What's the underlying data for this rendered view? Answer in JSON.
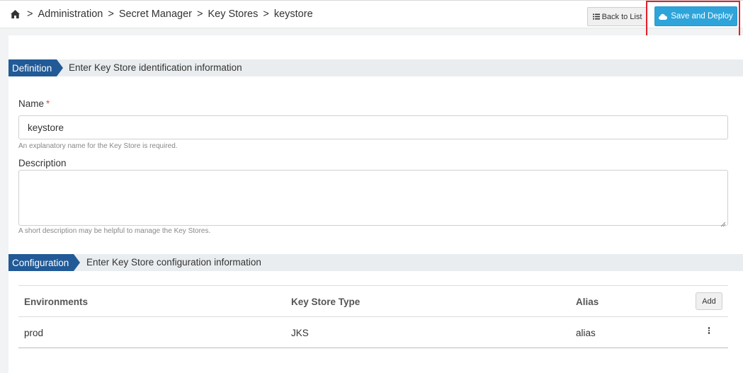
{
  "breadcrumb": {
    "home_icon": "home-icon",
    "separator": ">",
    "items": [
      "Administration",
      "Secret Manager",
      "Key Stores",
      "keystore"
    ]
  },
  "toolbar": {
    "back_label": "Back to List",
    "back_icon": "list-icon",
    "save_label": "Save and Deploy",
    "save_icon": "cloud-icon",
    "save_color": "#2ea4da",
    "highlight_color": "#e0202a"
  },
  "definition": {
    "tag": "Definition",
    "description": "Enter Key Store identification information",
    "name_label": "Name",
    "required_marker": "*",
    "name_value": "keystore",
    "name_help": "An explanatory name for the Key Store is required.",
    "description_label": "Description",
    "description_value": "",
    "description_help": "A short description may be helpful to manage the Key Stores."
  },
  "configuration": {
    "tag": "Configuration",
    "description": "Enter Key Store configuration information",
    "columns": [
      "Environments",
      "Key Store Type",
      "Alias"
    ],
    "add_label": "Add",
    "rows": [
      {
        "environment": "prod",
        "type": "JKS",
        "alias": "alias"
      }
    ]
  },
  "colors": {
    "section_tag": "#215a96",
    "section_bar": "#eaedef"
  }
}
